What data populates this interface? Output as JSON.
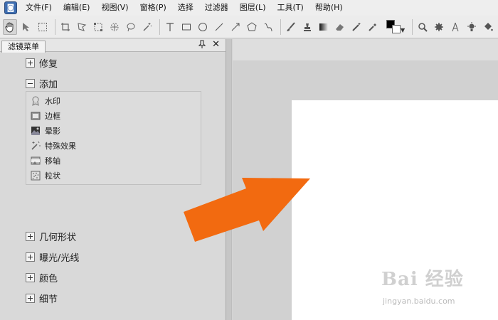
{
  "menubar": {
    "items": [
      "文件(F)",
      "编辑(E)",
      "视图(V)",
      "窗格(P)",
      "选择",
      "过滤器",
      "图层(L)",
      "工具(T)",
      "帮助(H)"
    ]
  },
  "toolbar": {
    "tools": [
      "pan",
      "move",
      "rect-select",
      "crop",
      "lasso",
      "transform",
      "move-selection",
      "ellipse-select",
      "magic-wand",
      "text",
      "rectangle",
      "ellipse",
      "line",
      "arrow",
      "polygon",
      "curve",
      "brush",
      "clone-stamp",
      "gradient",
      "eraser",
      "eyedropper",
      "color-picker",
      "zoom",
      "gear",
      "lamp",
      "light",
      "fill",
      "car"
    ],
    "foreground_color": "#000000",
    "background_color": "#ffffff"
  },
  "panel": {
    "tab_label": "滤镜菜单",
    "groups": [
      {
        "label": "修复",
        "expanded": false
      },
      {
        "label": "添加",
        "expanded": true,
        "items": [
          "水印",
          "边框",
          "晕影",
          "特殊效果",
          "移轴",
          "粒状"
        ]
      },
      {
        "label": "几何形状",
        "expanded": false
      },
      {
        "label": "曝光/光线",
        "expanded": false
      },
      {
        "label": "颜色",
        "expanded": false
      },
      {
        "label": "细节",
        "expanded": false
      }
    ]
  },
  "watermark": {
    "main": "Bai 经验",
    "sub": "jingyan.baidu.com"
  },
  "colors": {
    "arrow": "#f26a10",
    "document": "#ffffff",
    "canvas": "#d1d1d1"
  }
}
